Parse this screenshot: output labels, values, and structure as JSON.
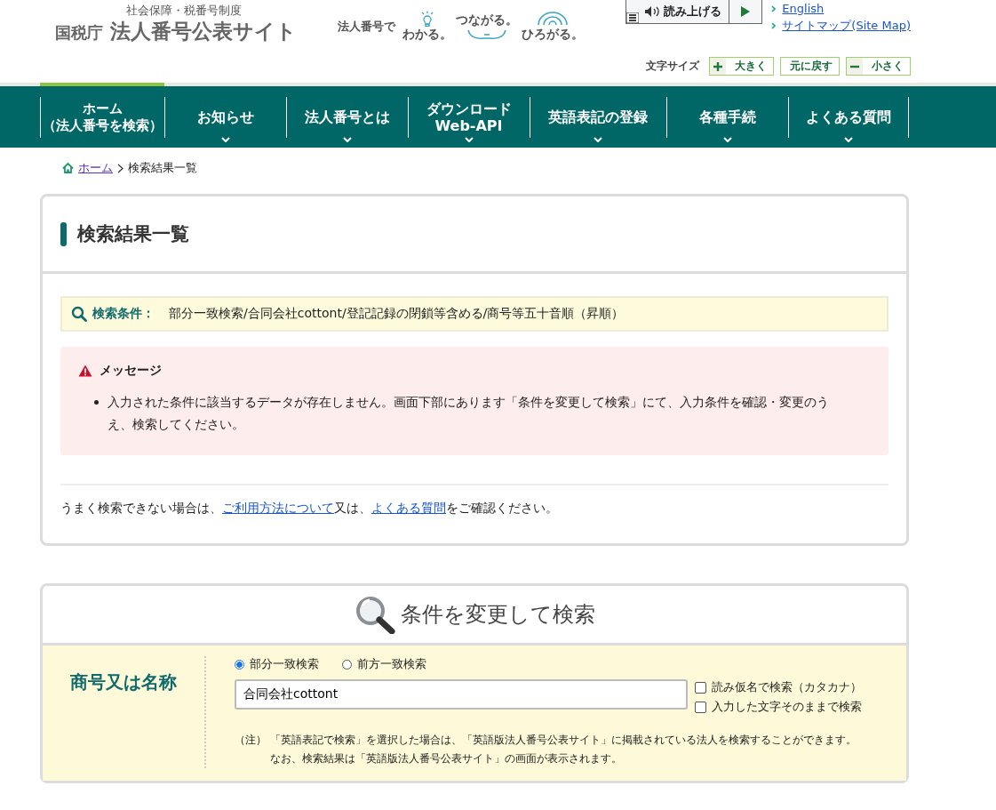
{
  "header": {
    "subtitle": "社会保障・税番号制度",
    "agency": "国税庁",
    "site_title": "法人番号公表サイト",
    "tagline": [
      "法人番号で",
      "わかる。",
      "つながる。",
      "ひろがる。"
    ]
  },
  "read_aloud": {
    "label": "読み上げる"
  },
  "header_links": [
    "English",
    "サイトマップ(Site Map)"
  ],
  "text_size": {
    "label": "文字サイズ",
    "buttons": [
      {
        "label": "大きく",
        "kind": "plus"
      },
      {
        "label": "元に戻す",
        "kind": "reset"
      },
      {
        "label": "小さく",
        "kind": "minus"
      }
    ]
  },
  "nav": [
    {
      "lines": [
        "ホーム",
        "（法人番号を検索）"
      ],
      "selected": true,
      "has_menu": false
    },
    {
      "lines": [
        "お知らせ"
      ],
      "selected": false,
      "has_menu": true
    },
    {
      "lines": [
        "法人番号とは"
      ],
      "selected": false,
      "has_menu": true
    },
    {
      "lines": [
        "ダウンロード",
        "Web-API"
      ],
      "selected": false,
      "has_menu": true
    },
    {
      "lines": [
        "英語表記の登録"
      ],
      "selected": false,
      "has_menu": true
    },
    {
      "lines": [
        "各種手続"
      ],
      "selected": false,
      "has_menu": true
    },
    {
      "lines": [
        "よくある質問"
      ],
      "selected": false,
      "has_menu": true
    }
  ],
  "breadcrumb": [
    {
      "label": "ホーム",
      "link": true
    },
    {
      "label": "検索結果一覧",
      "link": false
    }
  ],
  "results": {
    "title": "検索結果一覧",
    "condition_label": "検索条件：",
    "condition": "部分一致検索/合同会社cottont/登記記録の閉鎖等含める/商号等五十音順（昇順）",
    "message": {
      "title": "メッセージ",
      "items": [
        "入力された条件に該当するデータが存在しません。画面下部にあります「条件を変更して検索」にて、入力条件を確認・変更のうえ、検索してください。"
      ]
    },
    "help": [
      {
        "text": "うまく検索できない場合は、",
        "link": false
      },
      {
        "text": "ご利用方法について",
        "link": true
      },
      {
        "text": "又は、",
        "link": false
      },
      {
        "text": "よくある質問",
        "link": true
      },
      {
        "text": "をご確認ください。",
        "link": false
      }
    ]
  },
  "search": {
    "title": "条件を変更して検索",
    "field_label": "商号又は名称",
    "modes": [
      {
        "label": "部分一致検索",
        "selected": true
      },
      {
        "label": "前方一致検索",
        "selected": false
      }
    ],
    "value": "合同会社cottont",
    "options": [
      {
        "label": "読み仮名で検索（カタカナ）",
        "checked": false
      },
      {
        "label": "入力した文字そのままで検索",
        "checked": false
      }
    ],
    "note_mark": "（注）",
    "note": [
      "「英語表記で検索」を選択した場合は、「英語版法人番号公表サイト」に掲載されている法人を検索することができます。",
      "なお、検索結果は「英語版法人番号公表サイト」の画面が表示されます。"
    ]
  }
}
